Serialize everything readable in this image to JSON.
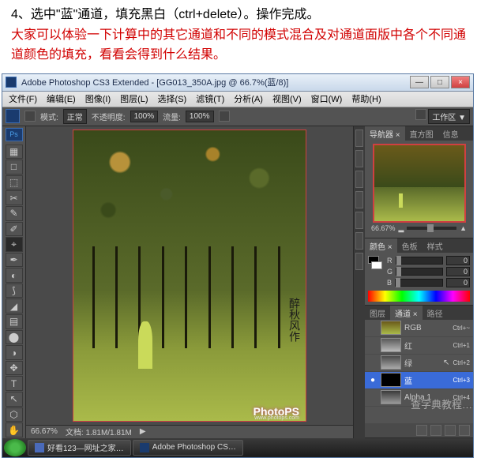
{
  "instruction": {
    "step": "4、选中\"蓝\"通道，填充黑白（ctrl+delete）。操作完成。",
    "note": "大家可以体验一下计算中的其它通道和不同的模式混合及对通道面版中各个不同通道颜色的填充，看看会得到什么结果。"
  },
  "titlebar": {
    "icon_label": "Ps",
    "title": "Adobe Photoshop CS3 Extended - [GG013_350A.jpg @ 66.7%(蓝/8)]",
    "min": "—",
    "max": "□",
    "close": "×"
  },
  "menu": [
    "文件(F)",
    "编辑(E)",
    "图像(I)",
    "图层(L)",
    "选择(S)",
    "滤镜(T)",
    "分析(A)",
    "视图(V)",
    "窗口(W)",
    "帮助(H)"
  ],
  "optbar": {
    "mode_label": "模式:",
    "mode_value": "正常",
    "opacity_label": "不透明度:",
    "opacity_value": "100%",
    "flow_label": "流量:",
    "flow_value": "100%",
    "workspace": "工作区 ▼"
  },
  "tools": [
    "▦",
    "□",
    "⬚",
    "✂",
    "✎",
    "✐",
    "⌖",
    "✒",
    "◐",
    "⟆",
    "◢",
    "▤",
    "⬤",
    "◑",
    "✥",
    "T",
    "↖",
    "⬡",
    "✋",
    "⊕"
  ],
  "canvas": {
    "wm_text": "醉秋风作",
    "logo": "PhotoPS",
    "logo_sub": "www.photops.com"
  },
  "statusbar": {
    "zoom": "66.67%",
    "doc": "文档: 1.81M/1.81M"
  },
  "nav": {
    "tabs": [
      "导航器 ×",
      "直方图",
      "信息"
    ],
    "zoom": "66.67%"
  },
  "color": {
    "tabs": [
      "颜色 ×",
      "色板",
      "样式"
    ],
    "r_label": "R",
    "r_val": "0",
    "g_label": "G",
    "g_val": "0",
    "b_label": "B",
    "b_val": "0"
  },
  "channels": {
    "tabs": [
      "图层",
      "通道 ×",
      "路径"
    ],
    "rows": [
      {
        "name": "RGB",
        "sc": "Ctrl+~",
        "sel": false,
        "eye": ""
      },
      {
        "name": "红",
        "sc": "Ctrl+1",
        "sel": false,
        "eye": ""
      },
      {
        "name": "绿",
        "sc": "Ctrl+2",
        "sel": false,
        "eye": ""
      },
      {
        "name": "蓝",
        "sc": "Ctrl+3",
        "sel": true,
        "eye": "●"
      },
      {
        "name": "Alpha 1",
        "sc": "Ctrl+4",
        "sel": false,
        "eye": ""
      }
    ]
  },
  "watermark": "查字典教程…",
  "taskbar": {
    "items": [
      "好看123—网址之家…",
      "Adobe Photoshop CS…"
    ]
  }
}
